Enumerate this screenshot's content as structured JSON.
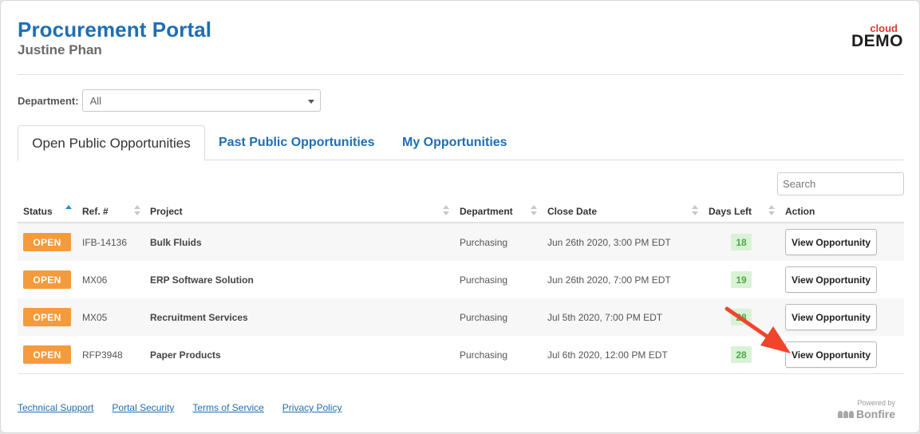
{
  "header": {
    "title": "Procurement Portal",
    "user_name": "Justine Phan",
    "logo_small": "cloud",
    "logo_main": "DEMO"
  },
  "filter": {
    "label": "Department:",
    "selected": "All"
  },
  "tabs": [
    {
      "label": "Open Public Opportunities",
      "active": true
    },
    {
      "label": "Past Public Opportunities",
      "active": false
    },
    {
      "label": "My Opportunities",
      "active": false
    }
  ],
  "search": {
    "placeholder": "Search"
  },
  "table": {
    "columns": [
      "Status",
      "Ref. #",
      "Project",
      "Department",
      "Close Date",
      "Days Left",
      "Action"
    ],
    "rows": [
      {
        "status": "OPEN",
        "ref": "IFB-14136",
        "project": "Bulk Fluids",
        "department": "Purchasing",
        "close_date": "Jun 26th 2020, 3:00 PM EDT",
        "days_left": "18",
        "action": "View Opportunity"
      },
      {
        "status": "OPEN",
        "ref": "MX06",
        "project": "ERP Software Solution",
        "department": "Purchasing",
        "close_date": "Jun 26th 2020, 7:00 PM EDT",
        "days_left": "19",
        "action": "View Opportunity"
      },
      {
        "status": "OPEN",
        "ref": "MX05",
        "project": "Recruitment Services",
        "department": "Purchasing",
        "close_date": "Jul 5th 2020, 7:00 PM EDT",
        "days_left": "28",
        "action": "View Opportunity"
      },
      {
        "status": "OPEN",
        "ref": "RFP3948",
        "project": "Paper Products",
        "department": "Purchasing",
        "close_date": "Jul 6th 2020, 12:00 PM EDT",
        "days_left": "28",
        "action": "View Opportunity"
      }
    ]
  },
  "footer": {
    "links": [
      "Technical Support",
      "Portal Security",
      "Terms of Service",
      "Privacy Policy"
    ],
    "powered_label": "Powered by",
    "powered_brand": "Bonfire"
  },
  "colors": {
    "brand_blue": "#1f6eb3",
    "open_badge": "#f59b3b",
    "days_badge_bg": "#d9f2d6",
    "days_badge_text": "#4caa45",
    "annotation_arrow": "#f0452b"
  },
  "icons": {
    "sort_asc": "triangle-up-icon",
    "sort_both": "sort-icon",
    "select_caret": "chevron-down-icon",
    "bonfire_logo": "bonfire-logo-icon",
    "annotation": "red-arrow-icon"
  }
}
